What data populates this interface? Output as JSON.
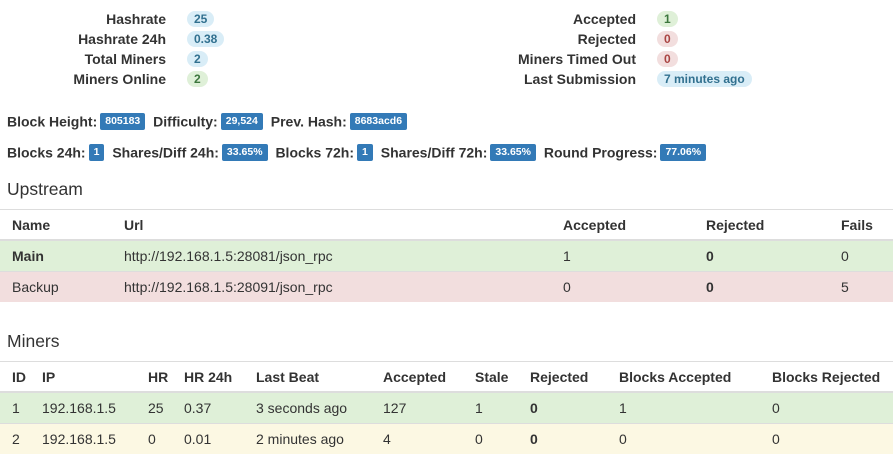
{
  "stats": {
    "left": [
      {
        "label": "Hashrate",
        "value": "25",
        "style": "info"
      },
      {
        "label": "Hashrate 24h",
        "value": "0.38",
        "style": "info"
      },
      {
        "label": "Total Miners",
        "value": "2",
        "style": "info"
      },
      {
        "label": "Miners Online",
        "value": "2",
        "style": "success"
      }
    ],
    "right": [
      {
        "label": "Accepted",
        "value": "1",
        "style": "success"
      },
      {
        "label": "Rejected",
        "value": "0",
        "style": "danger"
      },
      {
        "label": "Miners Timed Out",
        "value": "0",
        "style": "danger"
      },
      {
        "label": "Last Submission",
        "value": "7 minutes ago",
        "style": "info"
      }
    ]
  },
  "block_info": {
    "block_height_label": "Block Height:",
    "block_height": "805183",
    "difficulty_label": "Difficulty:",
    "difficulty": "29,524",
    "prev_hash_label": "Prev. Hash:",
    "prev_hash": "8683acd6"
  },
  "progress_info": {
    "blocks_24h_label": "Blocks 24h:",
    "blocks_24h": "1",
    "shares_diff_24h_label": "Shares/Diff 24h:",
    "shares_diff_24h": "33.65%",
    "blocks_72h_label": "Blocks 72h:",
    "blocks_72h": "1",
    "shares_diff_72h_label": "Shares/Diff 72h:",
    "shares_diff_72h": "33.65%",
    "round_progress_label": "Round Progress:",
    "round_progress": "77.06%"
  },
  "upstream": {
    "title": "Upstream",
    "headers": [
      "Name",
      "Url",
      "Accepted",
      "Rejected",
      "Fails"
    ],
    "rows": [
      {
        "name": "Main",
        "url": "http://192.168.1.5:28081/json_rpc",
        "accepted": "1",
        "rejected": "0",
        "fails": "0",
        "status": "success"
      },
      {
        "name": "Backup",
        "url": "http://192.168.1.5:28091/json_rpc",
        "accepted": "0",
        "rejected": "0",
        "fails": "5",
        "status": "danger"
      }
    ]
  },
  "miners": {
    "title": "Miners",
    "headers": [
      "ID",
      "IP",
      "HR",
      "HR 24h",
      "Last Beat",
      "Accepted",
      "Stale",
      "Rejected",
      "Blocks Accepted",
      "Blocks Rejected"
    ],
    "rows": [
      {
        "id": "1",
        "ip": "192.168.1.5",
        "hr": "25",
        "hr24": "0.37",
        "last_beat": "3 seconds ago",
        "accepted": "127",
        "stale": "1",
        "rejected": "0",
        "blocks_accepted": "1",
        "blocks_rejected": "0",
        "status": "success"
      },
      {
        "id": "2",
        "ip": "192.168.1.5",
        "hr": "0",
        "hr24": "0.01",
        "last_beat": "2 minutes ago",
        "accepted": "4",
        "stale": "0",
        "rejected": "0",
        "blocks_accepted": "0",
        "blocks_rejected": "0",
        "status": "warning"
      }
    ]
  }
}
